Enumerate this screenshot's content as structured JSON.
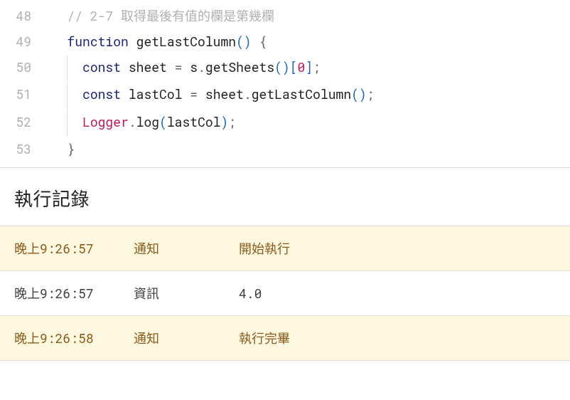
{
  "code": {
    "lines": [
      {
        "num": "48",
        "indent": 0,
        "tokens": [
          {
            "t": "   ",
            "cls": ""
          },
          {
            "t": "// 2-7 取得最後有值的欄是第幾欄",
            "cls": "tok-comment"
          }
        ]
      },
      {
        "num": "49",
        "indent": 0,
        "tokens": [
          {
            "t": "   ",
            "cls": ""
          },
          {
            "t": "function",
            "cls": "tok-keyword"
          },
          {
            "t": " ",
            "cls": ""
          },
          {
            "t": "getLastColumn",
            "cls": "tok-func"
          },
          {
            "t": "()",
            "cls": "tok-paren"
          },
          {
            "t": " ",
            "cls": ""
          },
          {
            "t": "{",
            "cls": "tok-punc"
          }
        ]
      },
      {
        "num": "50",
        "indent": 1,
        "tokens": [
          {
            "t": "  ",
            "cls": ""
          },
          {
            "t": "const",
            "cls": "tok-const"
          },
          {
            "t": " ",
            "cls": ""
          },
          {
            "t": "sheet",
            "cls": "tok-ident"
          },
          {
            "t": " ",
            "cls": ""
          },
          {
            "t": "=",
            "cls": "tok-punc"
          },
          {
            "t": " ",
            "cls": ""
          },
          {
            "t": "s",
            "cls": "tok-ident"
          },
          {
            "t": ".",
            "cls": "tok-punc"
          },
          {
            "t": "getSheets",
            "cls": "tok-func"
          },
          {
            "t": "()[",
            "cls": "tok-paren"
          },
          {
            "t": "0",
            "cls": "tok-num"
          },
          {
            "t": "]",
            "cls": "tok-paren"
          },
          {
            "t": ";",
            "cls": "tok-punc"
          }
        ]
      },
      {
        "num": "51",
        "indent": 1,
        "tokens": [
          {
            "t": "  ",
            "cls": ""
          },
          {
            "t": "const",
            "cls": "tok-const"
          },
          {
            "t": " ",
            "cls": ""
          },
          {
            "t": "lastCol",
            "cls": "tok-ident"
          },
          {
            "t": " ",
            "cls": ""
          },
          {
            "t": "=",
            "cls": "tok-punc"
          },
          {
            "t": " ",
            "cls": ""
          },
          {
            "t": "sheet",
            "cls": "tok-ident"
          },
          {
            "t": ".",
            "cls": "tok-punc"
          },
          {
            "t": "getLastColumn",
            "cls": "tok-func"
          },
          {
            "t": "()",
            "cls": "tok-paren"
          },
          {
            "t": ";",
            "cls": "tok-punc"
          }
        ]
      },
      {
        "num": "52",
        "indent": 1,
        "tokens": [
          {
            "t": "  ",
            "cls": ""
          },
          {
            "t": "Logger",
            "cls": "tok-logger"
          },
          {
            "t": ".",
            "cls": "tok-punc"
          },
          {
            "t": "log",
            "cls": "tok-func"
          },
          {
            "t": "(",
            "cls": "tok-paren"
          },
          {
            "t": "lastCol",
            "cls": "tok-ident"
          },
          {
            "t": ")",
            "cls": "tok-paren"
          },
          {
            "t": ";",
            "cls": "tok-punc"
          }
        ]
      },
      {
        "num": "53",
        "indent": 0,
        "tokens": [
          {
            "t": "   ",
            "cls": ""
          },
          {
            "t": "}",
            "cls": "tok-punc"
          }
        ]
      }
    ]
  },
  "log": {
    "header": "執行記錄",
    "rows": [
      {
        "time": "晚上9:26:57",
        "level": "通知",
        "msg": "開始執行",
        "kind": "notify"
      },
      {
        "time": "晚上9:26:57",
        "level": "資訊",
        "msg": "4.0",
        "kind": "info"
      },
      {
        "time": "晚上9:26:58",
        "level": "通知",
        "msg": "執行完畢",
        "kind": "notify"
      }
    ]
  }
}
